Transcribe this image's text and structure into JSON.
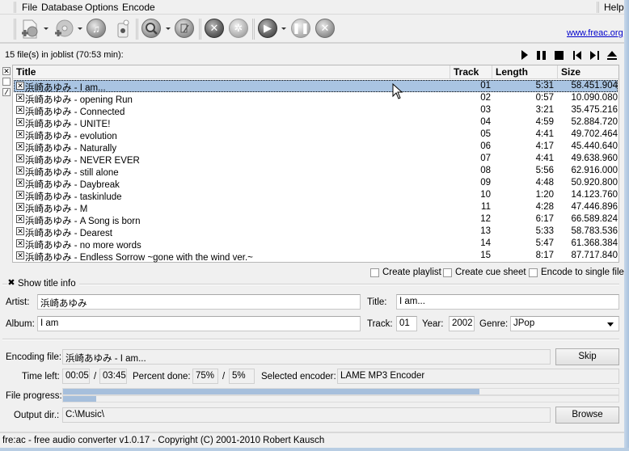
{
  "menu": [
    "File",
    "Database",
    "Options",
    "Encode"
  ],
  "help_label": "Help",
  "toolbar": {
    "buttons": [
      {
        "name": "add-files-icon"
      },
      {
        "name": "add-cd-icon"
      },
      {
        "name": "add-audio-icon"
      },
      {
        "name": "clear-joblist-icon"
      },
      {
        "name": "query-cddb-icon"
      },
      {
        "name": "submit-cddb-icon"
      },
      {
        "name": "configure-icon"
      },
      {
        "name": "settings-gear-icon"
      },
      {
        "name": "start-encoding-icon"
      },
      {
        "name": "pause-icon"
      },
      {
        "name": "stop-icon"
      }
    ],
    "link": "www.freac.org"
  },
  "joblist": {
    "info": "15 file(s) in joblist (70:53 min):",
    "columns": [
      "Title",
      "Track",
      "Length",
      "Size"
    ],
    "selected_index": 0,
    "rows": [
      {
        "title": "浜崎あゆみ - I am...",
        "track": "01",
        "length": "5:31",
        "size": "58.451.904"
      },
      {
        "title": "浜崎あゆみ - opening Run",
        "track": "02",
        "length": "0:57",
        "size": "10.090.080"
      },
      {
        "title": "浜崎あゆみ - Connected",
        "track": "03",
        "length": "3:21",
        "size": "35.475.216"
      },
      {
        "title": "浜崎あゆみ - UNITE!",
        "track": "04",
        "length": "4:59",
        "size": "52.884.720"
      },
      {
        "title": "浜崎あゆみ - evolution",
        "track": "05",
        "length": "4:41",
        "size": "49.702.464"
      },
      {
        "title": "浜崎あゆみ - Naturally",
        "track": "06",
        "length": "4:17",
        "size": "45.440.640"
      },
      {
        "title": "浜崎あゆみ - NEVER EVER",
        "track": "07",
        "length": "4:41",
        "size": "49.638.960"
      },
      {
        "title": "浜崎あゆみ - still alone",
        "track": "08",
        "length": "5:56",
        "size": "62.916.000"
      },
      {
        "title": "浜崎あゆみ - Daybreak",
        "track": "09",
        "length": "4:48",
        "size": "50.920.800"
      },
      {
        "title": "浜崎あゆみ - taskinlude",
        "track": "10",
        "length": "1:20",
        "size": "14.123.760"
      },
      {
        "title": "浜崎あゆみ - M",
        "track": "11",
        "length": "4:28",
        "size": "47.446.896"
      },
      {
        "title": "浜崎あゆみ - A Song is born",
        "track": "12",
        "length": "6:17",
        "size": "66.589.824"
      },
      {
        "title": "浜崎あゆみ - Dearest",
        "track": "13",
        "length": "5:33",
        "size": "58.783.536"
      },
      {
        "title": "浜崎あゆみ - no more words",
        "track": "14",
        "length": "5:47",
        "size": "61.368.384"
      },
      {
        "title": "浜崎あゆみ - Endless Sorrow ~gone with the wind ver.~",
        "track": "15",
        "length": "8:17",
        "size": "87.717.840"
      }
    ]
  },
  "options": {
    "create_playlist": "Create playlist",
    "create_cue_sheet": "Create cue sheet",
    "encode_single": "Encode to single file"
  },
  "title_info": {
    "toggle_label": "Show title info",
    "artist_label": "Artist:",
    "artist": "浜崎あゆみ",
    "title_label": "Title:",
    "title": "I am...",
    "album_label": "Album:",
    "album": "I am",
    "track_label": "Track:",
    "track": "01",
    "year_label": "Year:",
    "year": "2002",
    "genre_label": "Genre:",
    "genre": "JPop"
  },
  "encoding": {
    "file_label": "Encoding file:",
    "file": "浜崎あゆみ - I am...",
    "skip_label": "Skip",
    "time_left_label": "Time left:",
    "time_left": "00:05",
    "slash": "/",
    "time_total": "03:45",
    "percent_label": "Percent done:",
    "percent_file": "75%",
    "percent_total": "5%",
    "encoder_label": "Selected encoder:",
    "encoder": "LAME MP3 Encoder",
    "progress_label": "File progress:",
    "file_progress": 0.75,
    "total_progress": 0.06,
    "output_label": "Output dir.:",
    "output_dir": "C:\\Music\\",
    "browse_label": "Browse"
  },
  "status": "fre:ac - free audio converter v1.0.17 - Copyright (C) 2001-2010 Robert Kausch"
}
